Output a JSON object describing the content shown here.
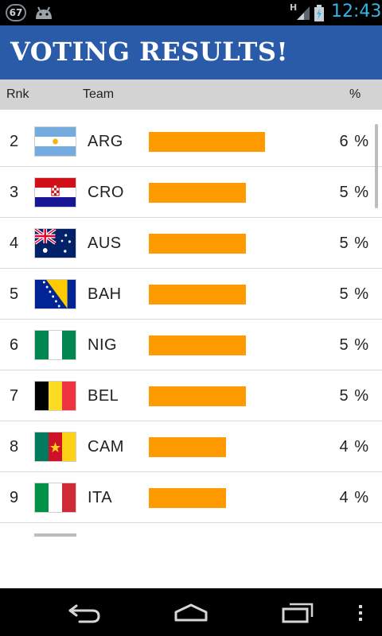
{
  "status_bar": {
    "notification_count": "67",
    "network_type": "H",
    "time": "12:43",
    "time_color": "#33b5e5"
  },
  "header": {
    "title": "VOTING RESULTS!",
    "background_color": "#2a5ba8"
  },
  "columns": {
    "rank": "Rnk",
    "team": "Team",
    "percent": "%"
  },
  "accent_bar_color": "#ff9a00",
  "rows": [
    {
      "rank": "2",
      "flag": "argentina-flag",
      "team": "ARG",
      "percent": "6 %",
      "value": 6
    },
    {
      "rank": "3",
      "flag": "croatia-flag",
      "team": "CRO",
      "percent": "5 %",
      "value": 5
    },
    {
      "rank": "4",
      "flag": "australia-flag",
      "team": "AUS",
      "percent": "5 %",
      "value": 5
    },
    {
      "rank": "5",
      "flag": "bosnia-herzegovina-flag",
      "team": "BAH",
      "percent": "5 %",
      "value": 5
    },
    {
      "rank": "6",
      "flag": "nigeria-flag",
      "team": "NIG",
      "percent": "5 %",
      "value": 5
    },
    {
      "rank": "7",
      "flag": "belgium-flag",
      "team": "BEL",
      "percent": "5 %",
      "value": 5
    },
    {
      "rank": "8",
      "flag": "cameroon-flag",
      "team": "CAM",
      "percent": "4 %",
      "value": 4
    },
    {
      "rank": "9",
      "flag": "italy-flag",
      "team": "ITA",
      "percent": "4 %",
      "value": 4
    }
  ],
  "nav_bar": {
    "back": "back-icon",
    "home": "home-icon",
    "recents": "recent-apps-icon",
    "menu": "overflow-menu-icon"
  }
}
